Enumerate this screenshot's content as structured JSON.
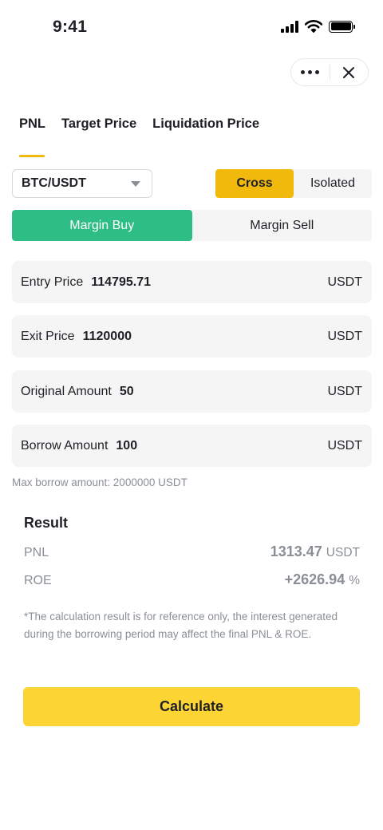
{
  "status_bar": {
    "time": "9:41"
  },
  "tabs": [
    {
      "label": "PNL",
      "active": true
    },
    {
      "label": "Target Price",
      "active": false
    },
    {
      "label": "Liquidation Price",
      "active": false
    }
  ],
  "pair": {
    "selected": "BTC/USDT"
  },
  "margin_mode": {
    "options": [
      "Cross",
      "Isolated"
    ],
    "selected": "Cross"
  },
  "side": {
    "options": [
      "Margin Buy",
      "Margin Sell"
    ],
    "selected": "Margin Buy"
  },
  "fields": [
    {
      "label": "Entry Price",
      "value": "114795.71",
      "unit": "USDT"
    },
    {
      "label": "Exit Price",
      "value": "1120000",
      "unit": "USDT"
    },
    {
      "label": "Original Amount",
      "value": "50",
      "unit": "USDT"
    },
    {
      "label": "Borrow Amount",
      "value": "100",
      "unit": "USDT"
    }
  ],
  "hint": "Max borrow amount: 2000000 USDT",
  "result": {
    "title": "Result",
    "pnl": {
      "label": "PNL",
      "value": "1313.47",
      "unit": "USDT"
    },
    "roe": {
      "label": "ROE",
      "value": "+2626.94",
      "unit": "%"
    }
  },
  "disclaimer": "*The calculation result is for reference only, the interest generated during the borrowing period may affect the final PNL & ROE.",
  "calculate_label": "Calculate",
  "colors": {
    "accent": "#f0b90b",
    "button": "#fcd535",
    "buy": "#2ebd85",
    "muted": "#8a8f96"
  }
}
